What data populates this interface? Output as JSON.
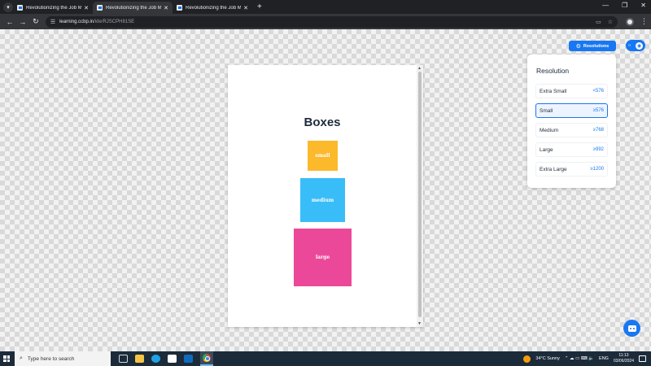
{
  "browser": {
    "tabs": [
      {
        "title": "Revolutionizing the Job Market",
        "active": false
      },
      {
        "title": "Revolutionizing the Job Market",
        "active": true
      },
      {
        "title": "Revolutionizing the Job Market",
        "active": false
      }
    ],
    "new_tab_glyph": "+",
    "url_host": "learning.ccbp.in",
    "url_path": "/ide/RJSCPH81SE"
  },
  "preview": {
    "heading": "Boxes",
    "boxes": [
      {
        "label": "small",
        "color": "#fbb92b"
      },
      {
        "label": "medium",
        "color": "#38bdf8"
      },
      {
        "label": "large",
        "color": "#ec4899"
      }
    ]
  },
  "toolbar": {
    "resolutions_label": "Resolutions"
  },
  "resolution_panel": {
    "title": "Resolution",
    "items": [
      {
        "label": "Extra Small",
        "value": "<576",
        "selected": false
      },
      {
        "label": "Small",
        "value": "≥576",
        "selected": true
      },
      {
        "label": "Medium",
        "value": "≥768",
        "selected": false
      },
      {
        "label": "Large",
        "value": "≥992",
        "selected": false
      },
      {
        "label": "Extra Large",
        "value": "≥1200",
        "selected": false
      }
    ]
  },
  "taskbar": {
    "search_placeholder": "Type here to search",
    "weather": "34°C  Sunny",
    "language": "ENG",
    "time": "11:13",
    "date": "03/06/2024"
  },
  "colors": {
    "accent": "#1877f2"
  }
}
